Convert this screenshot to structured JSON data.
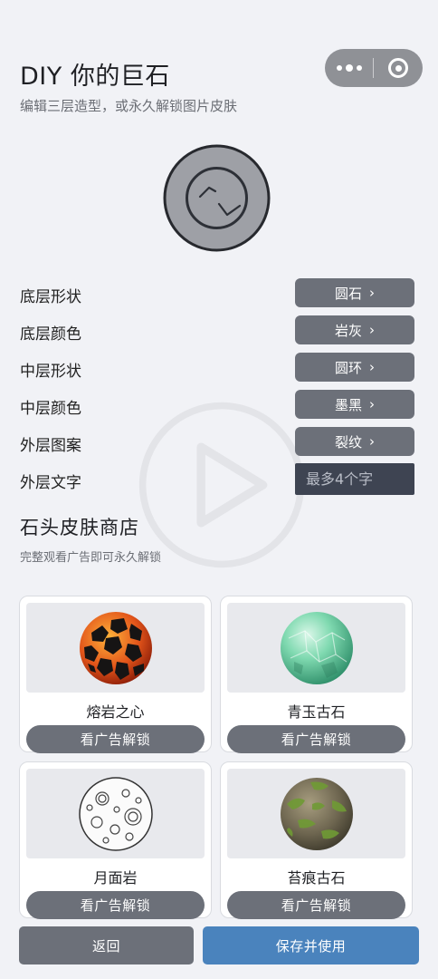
{
  "header": {
    "title": "DIY 你的巨石",
    "subtitle": "编辑三层造型，或永久解锁图片皮肤"
  },
  "capsule": {
    "more_icon": "more-dots-icon",
    "close_icon": "target-close-icon"
  },
  "options": [
    {
      "label": "底层形状",
      "value": "圆石"
    },
    {
      "label": "底层颜色",
      "value": "岩灰"
    },
    {
      "label": "中层形状",
      "value": "圆环"
    },
    {
      "label": "中层颜色",
      "value": "墨黑"
    },
    {
      "label": "外层图案",
      "value": "裂纹"
    }
  ],
  "outer_text": {
    "label": "外层文字",
    "placeholder": "最多4个字",
    "value": ""
  },
  "shop": {
    "title": "石头皮肤商店",
    "subtitle": "完整观看广告即可永久解锁",
    "unlock_label": "看广告解锁",
    "skins": [
      {
        "name": "熔岩之心"
      },
      {
        "name": "青玉古石"
      },
      {
        "name": "月面岩"
      },
      {
        "name": "苔痕古石"
      }
    ]
  },
  "footer": {
    "back_label": "返回",
    "save_label": "保存并使用"
  },
  "colors": {
    "background": "#f1f2f6",
    "button_gray": "#6c7079",
    "primary_blue": "#4a83bd",
    "input_dark": "#3e4452"
  }
}
